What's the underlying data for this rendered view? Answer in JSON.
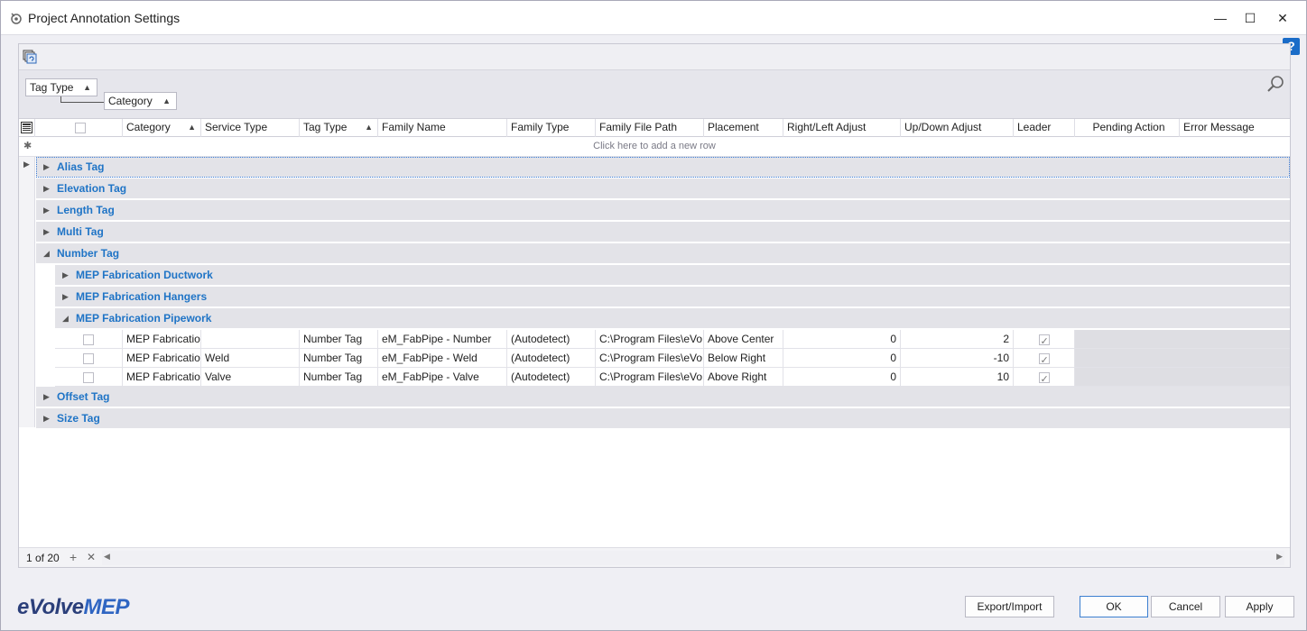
{
  "window": {
    "title": "Project Annotation Settings",
    "controls": {
      "minimize": "—",
      "maximize": "☐",
      "close": "✕"
    },
    "help": "?"
  },
  "grouping": {
    "chips": [
      {
        "label": "Tag Type",
        "sort": "▲"
      },
      {
        "label": "Category",
        "sort": "▲"
      }
    ]
  },
  "columns": [
    {
      "label": "",
      "kind": "checkbox"
    },
    {
      "label": "Category",
      "sort": "▲"
    },
    {
      "label": "Service Type"
    },
    {
      "label": "Tag Type",
      "sort": "▲"
    },
    {
      "label": "Family Name"
    },
    {
      "label": "Family Type"
    },
    {
      "label": "Family File Path"
    },
    {
      "label": "Placement"
    },
    {
      "label": "Right/Left Adjust"
    },
    {
      "label": "Up/Down Adjust"
    },
    {
      "label": "Leader"
    },
    {
      "label": "Pending Action"
    },
    {
      "label": "Error Message"
    }
  ],
  "new_row_text": "Click here to add a new row",
  "groups": [
    {
      "label": "Alias Tag",
      "level": 0,
      "expanded": false,
      "focused": true
    },
    {
      "label": "Elevation Tag",
      "level": 0,
      "expanded": false
    },
    {
      "label": "Length Tag",
      "level": 0,
      "expanded": false
    },
    {
      "label": "Multi Tag",
      "level": 0,
      "expanded": false
    },
    {
      "label": "Number Tag",
      "level": 0,
      "expanded": true
    },
    {
      "label": "MEP Fabrication Ductwork",
      "level": 1,
      "expanded": false
    },
    {
      "label": "MEP Fabrication Hangers",
      "level": 1,
      "expanded": false
    },
    {
      "label": "MEP Fabrication Pipework",
      "level": 1,
      "expanded": true
    },
    {
      "label": "Offset Tag",
      "level": 0,
      "expanded": false
    },
    {
      "label": "Size Tag",
      "level": 0,
      "expanded": false
    }
  ],
  "rows": [
    {
      "checked": false,
      "category": "MEP Fabricatio...",
      "service_type": "",
      "tag_type": "Number Tag",
      "family_name": "eM_FabPipe - Number",
      "family_type": "(Autodetect)",
      "file_path": "C:\\Program Files\\eVo...",
      "placement": "Above Center",
      "right_left": "0",
      "up_down": "2",
      "leader": true
    },
    {
      "checked": false,
      "category": "MEP Fabricatio...",
      "service_type": "Weld",
      "tag_type": "Number Tag",
      "family_name": "eM_FabPipe - Weld",
      "family_type": "(Autodetect)",
      "file_path": "C:\\Program Files\\eVo...",
      "placement": "Below Right",
      "right_left": "0",
      "up_down": "-10",
      "leader": true
    },
    {
      "checked": false,
      "category": "MEP Fabricatio...",
      "service_type": "Valve",
      "tag_type": "Number Tag",
      "family_name": "eM_FabPipe - Valve",
      "family_type": "(Autodetect)",
      "file_path": "C:\\Program Files\\eVo...",
      "placement": "Above Right",
      "right_left": "0",
      "up_down": "10",
      "leader": true
    }
  ],
  "footer": {
    "pager": "1 of 20",
    "add": "+",
    "remove": "✕"
  },
  "logo": {
    "part1": "eVolve",
    "part2": "MEP"
  },
  "buttons": {
    "export_import": "Export/Import",
    "ok": "OK",
    "cancel": "Cancel",
    "apply": "Apply"
  },
  "colors": {
    "group_text": "#1f74c6",
    "accent": "#3c7fd0",
    "help": "#1a6cc8"
  }
}
